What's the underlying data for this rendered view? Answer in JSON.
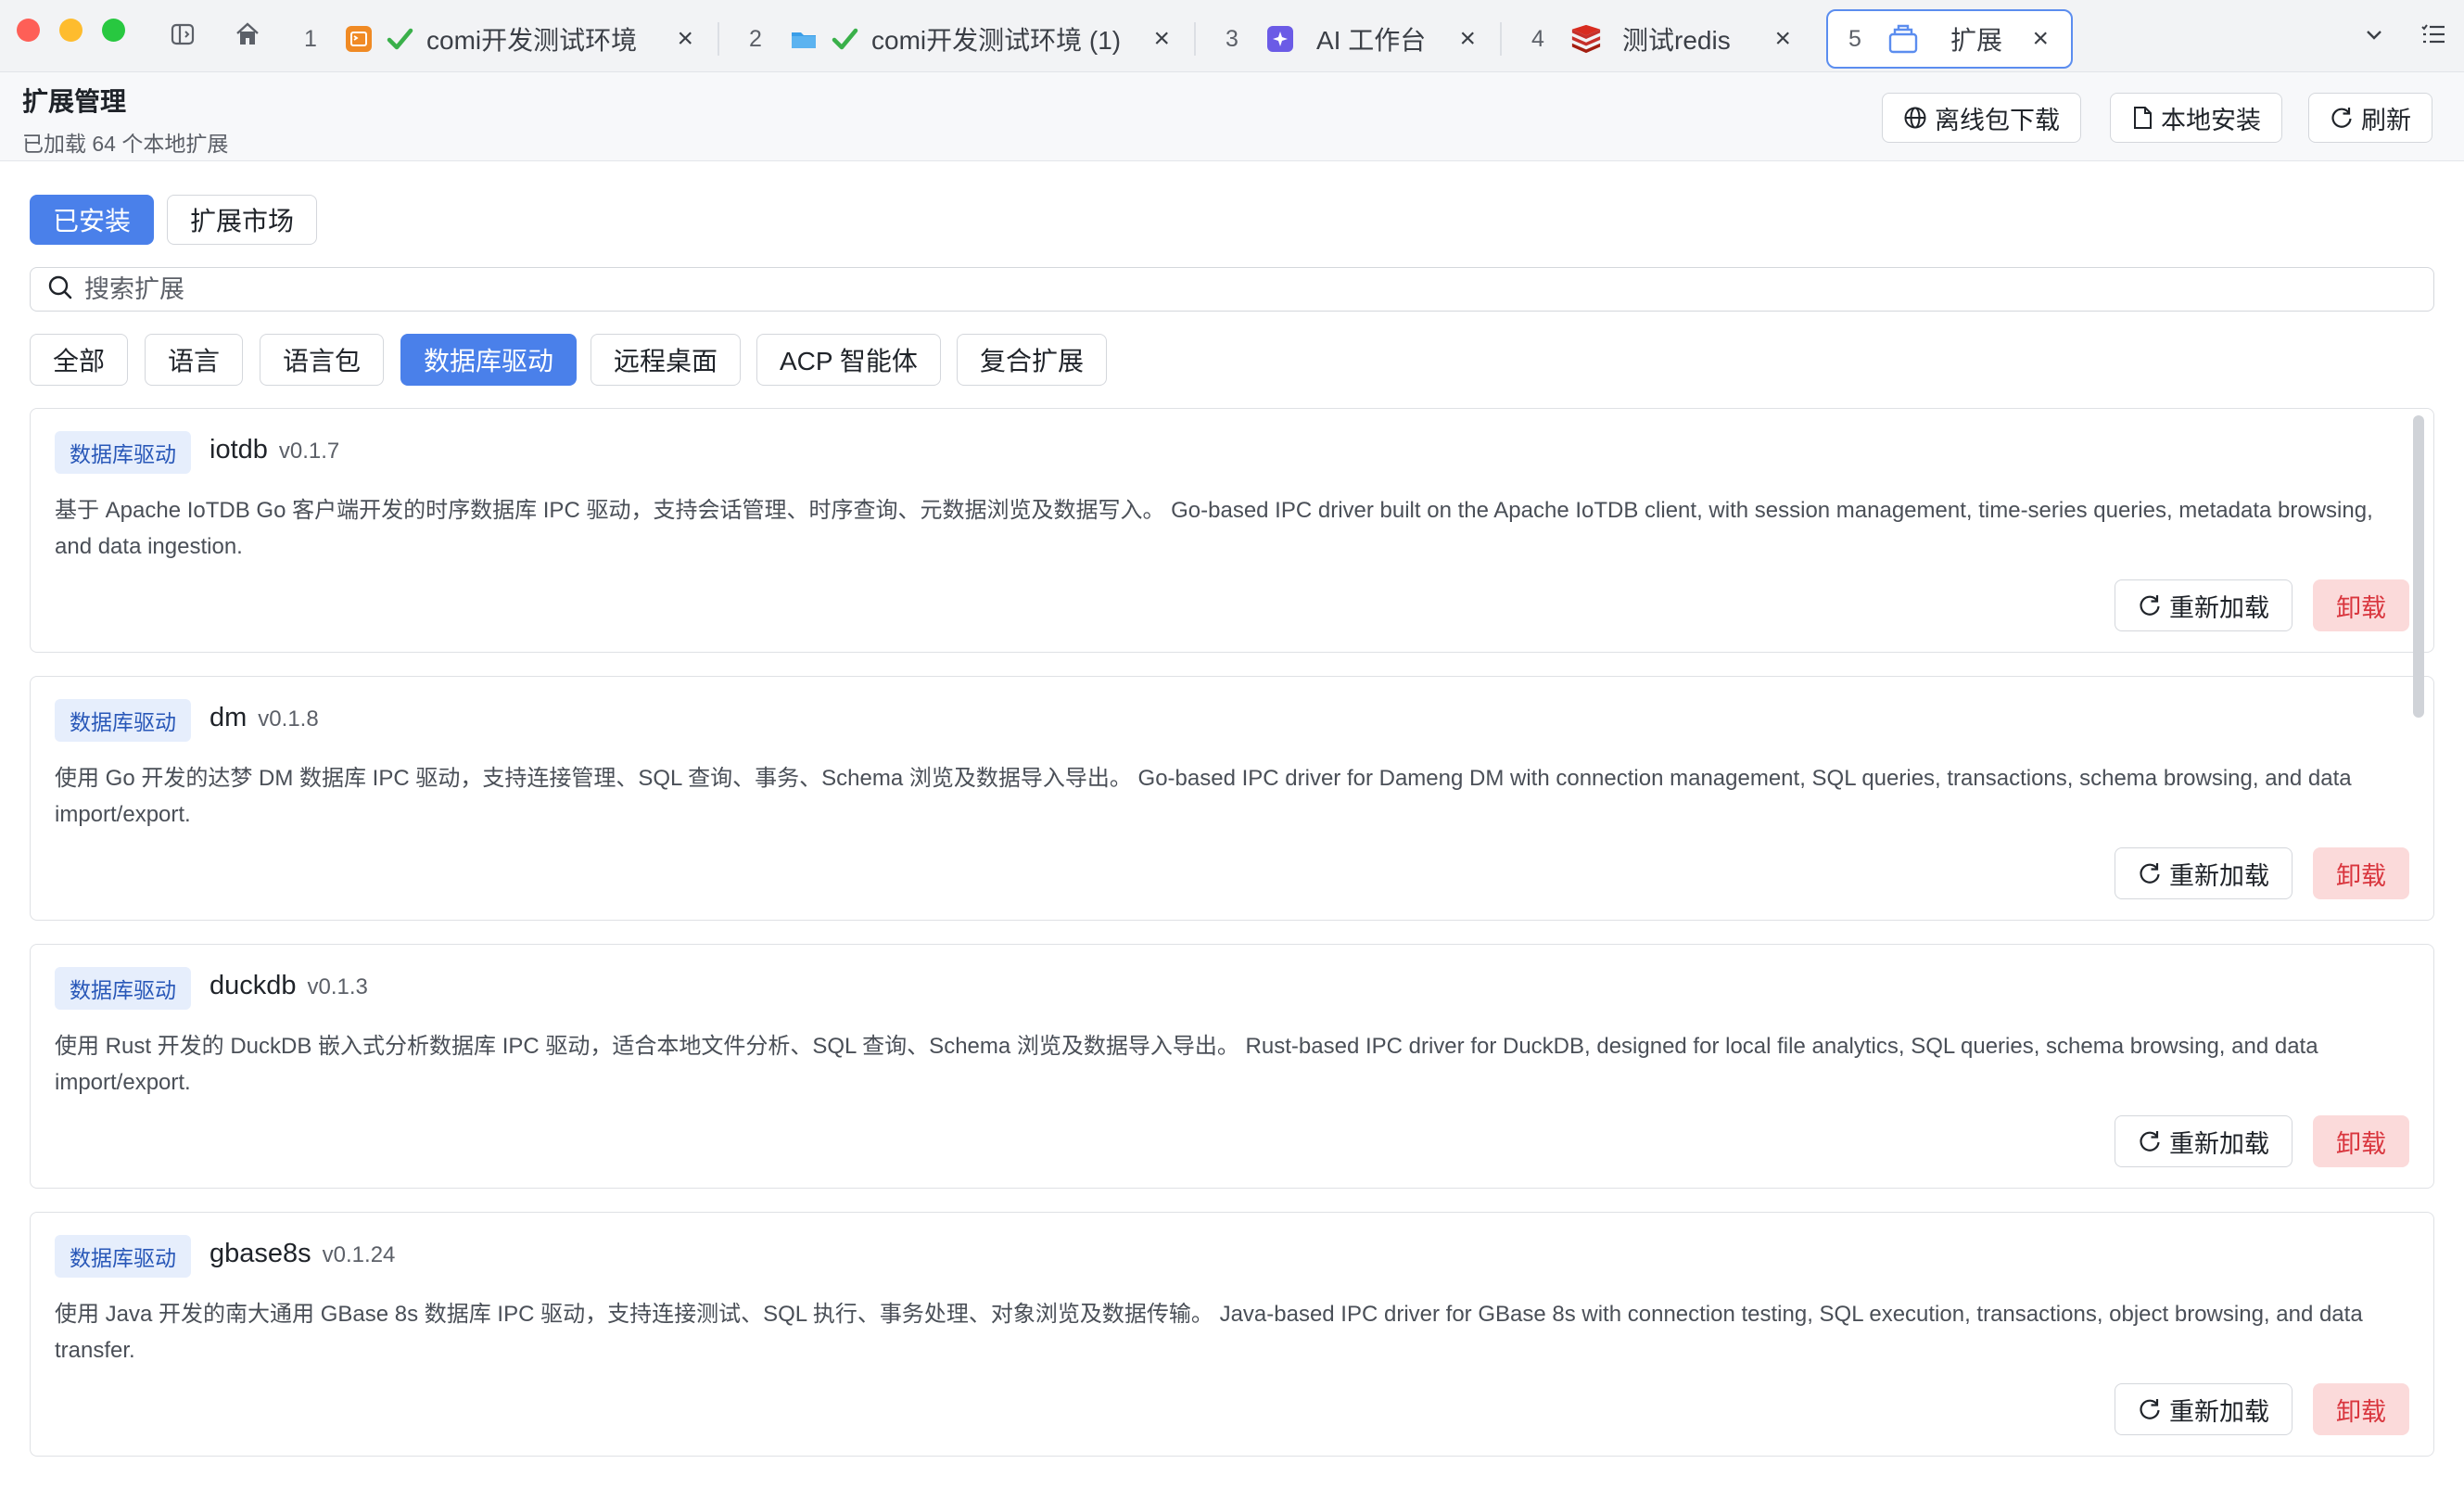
{
  "tabs": [
    {
      "num": "1",
      "title": "comi开发测试环境",
      "icon": "terminal-icon",
      "status": "check-icon"
    },
    {
      "num": "2",
      "title": "comi开发测试环境 (1)",
      "icon": "folder-icon",
      "status": "check-icon"
    },
    {
      "num": "3",
      "title": "AI 工作台",
      "icon": "ai-icon"
    },
    {
      "num": "4",
      "title": "测试redis",
      "icon": "redis-icon"
    },
    {
      "num": "5",
      "title": "扩展",
      "icon": "extension-icon",
      "active": true
    }
  ],
  "header": {
    "title": "扩展管理",
    "subtitle": "已加载 64 个本地扩展",
    "offline_download": "离线包下载",
    "local_install": "本地安装",
    "refresh": "刷新"
  },
  "segments": {
    "installed": "已安装",
    "market": "扩展市场"
  },
  "search": {
    "placeholder": "搜索扩展",
    "value": ""
  },
  "filters": [
    "全部",
    "语言",
    "语言包",
    "数据库驱动",
    "远程桌面",
    "ACP 智能体",
    "复合扩展"
  ],
  "active_filter": "数据库驱动",
  "extensions": [
    {
      "badge": "数据库驱动",
      "name": "iotdb",
      "version": "v0.1.7",
      "description": "基于 Apache IoTDB Go 客户端开发的时序数据库 IPC 驱动，支持会话管理、时序查询、元数据浏览及数据写入。 Go-based IPC driver built on the Apache IoTDB client, with session management, time-series queries, metadata browsing, and data ingestion."
    },
    {
      "badge": "数据库驱动",
      "name": "dm",
      "version": "v0.1.8",
      "description": "使用 Go 开发的达梦 DM 数据库 IPC 驱动，支持连接管理、SQL 查询、事务、Schema 浏览及数据导入导出。 Go-based IPC driver for Dameng DM with connection management, SQL queries, transactions, schema browsing, and data import/export."
    },
    {
      "badge": "数据库驱动",
      "name": "duckdb",
      "version": "v0.1.3",
      "description": "使用 Rust 开发的 DuckDB 嵌入式分析数据库 IPC 驱动，适合本地文件分析、SQL 查询、Schema 浏览及数据导入导出。 Rust-based IPC driver for DuckDB, designed for local file analytics, SQL queries, schema browsing, and data import/export."
    },
    {
      "badge": "数据库驱动",
      "name": "gbase8s",
      "version": "v0.1.24",
      "description": "使用 Java 开发的南大通用 GBase 8s 数据库 IPC 驱动，支持连接测试、SQL 执行、事务处理、对象浏览及数据传输。 Java-based IPC driver for GBase 8s with connection testing, SQL execution, transactions, object browsing, and data transfer."
    }
  ],
  "actions": {
    "reload": "重新加载",
    "uninstall": "卸载"
  },
  "colors": {
    "accent": "#4a80ea",
    "danger": "#d9363e",
    "danger_bg": "#fbdada",
    "badge_bg": "#e6eefc"
  }
}
